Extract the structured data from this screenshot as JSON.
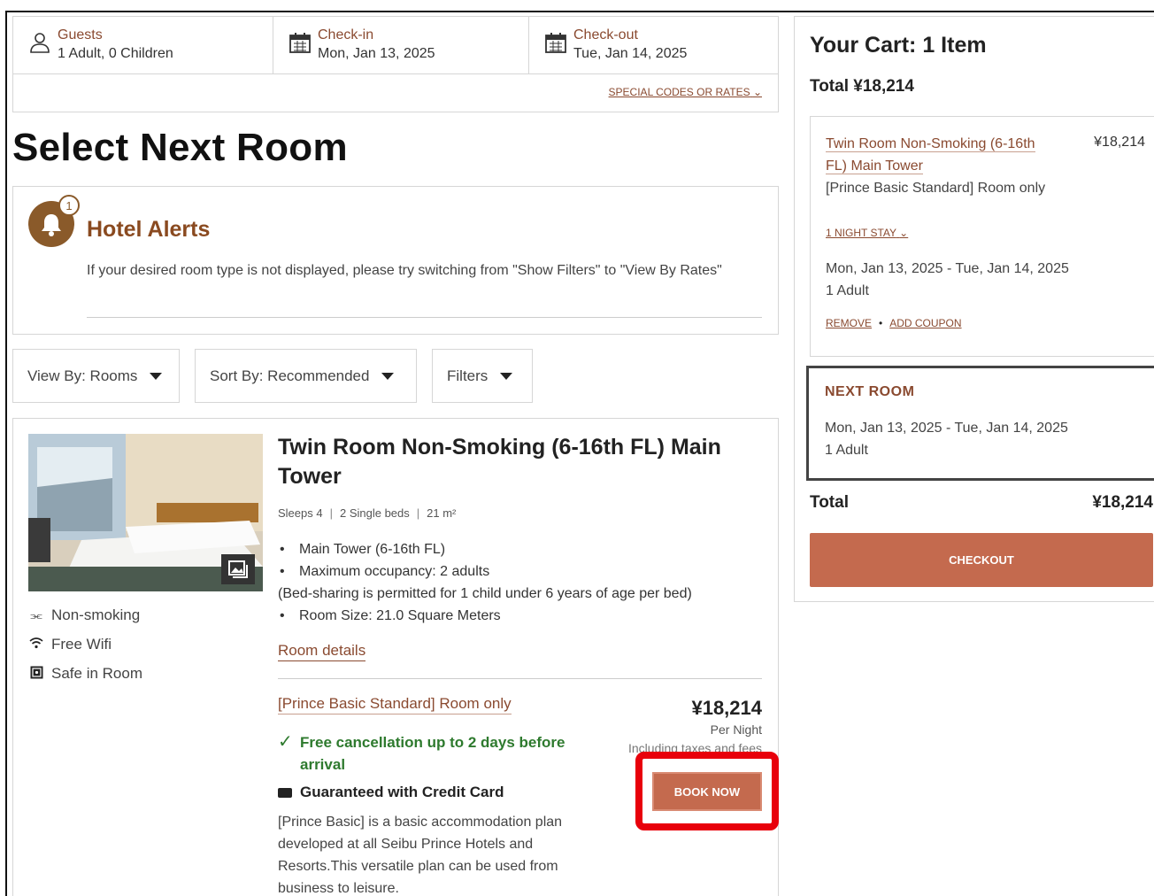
{
  "booking": {
    "guests_label": "Guests",
    "guests_value": "1 Adult, 0 Children",
    "checkin_label": "Check-in",
    "checkin_value": "Mon, Jan 13, 2025",
    "checkout_label": "Check-out",
    "checkout_value": "Tue, Jan 14, 2025",
    "special_codes": "SPECIAL CODES OR RATES"
  },
  "page_title": "Select Next Room",
  "alerts": {
    "count": "1",
    "title": "Hotel Alerts",
    "message": "If your desired room type is not displayed, please try switching from \"Show Filters\" to \"View By Rates\""
  },
  "filters": {
    "view_by": "View By: Rooms",
    "sort_by": "Sort By: Recommended",
    "filters": "Filters"
  },
  "room": {
    "title": "Twin Room Non-Smoking (6-16th FL) Main Tower",
    "sleeps": "Sleeps 4",
    "beds": "2 Single beds",
    "size": "21 m²",
    "features": [
      "Main Tower (6-16th FL)",
      "Maximum occupancy: 2 adults",
      "(Bed-sharing is permitted for 1 child under 6 years of age per bed)",
      "Room Size: 21.0 Square Meters"
    ],
    "amenities": [
      "Non-smoking",
      "Free Wifi",
      "Safe in Room"
    ],
    "details_link": "Room details",
    "plan_name": "[Prince Basic Standard] Room only",
    "price": "¥18,214",
    "per_night": "Per Night",
    "including": "Including taxes and fees",
    "cancellation": "Free cancellation up to 2 days before arrival",
    "guarantee": "Guaranteed with Credit Card",
    "plan_description": "[Prince Basic] is a basic accommodation plan developed at all Seibu Prince Hotels and Resorts.This versatile plan can be used from business to leisure.",
    "book_now": "BOOK NOW"
  },
  "cart": {
    "title": "Your Cart: 1 Item",
    "total": "Total ¥18,214",
    "item_name": "Twin Room Non-Smoking (6-16th FL) Main Tower",
    "item_price": "¥18,214",
    "item_plan": "[Prince Basic Standard] Room only",
    "night_stay": "1 NIGHT STAY",
    "item_dates": "Mon, Jan 13, 2025 - Tue, Jan 14, 2025",
    "item_guests": "1 Adult",
    "remove": "REMOVE",
    "add_coupon": "ADD COUPON",
    "next_room_title": "NEXT ROOM",
    "next_room_dates": "Mon, Jan 13, 2025 - Tue, Jan 14, 2025",
    "next_room_guests": "1 Adult",
    "total_label": "Total",
    "total_value": "¥18,214",
    "checkout": "CHECKOUT"
  },
  "colors": {
    "accent": "#8a4a30",
    "button": "#c46a4e",
    "highlight": "#e8000b",
    "success": "#2e7a2e"
  }
}
